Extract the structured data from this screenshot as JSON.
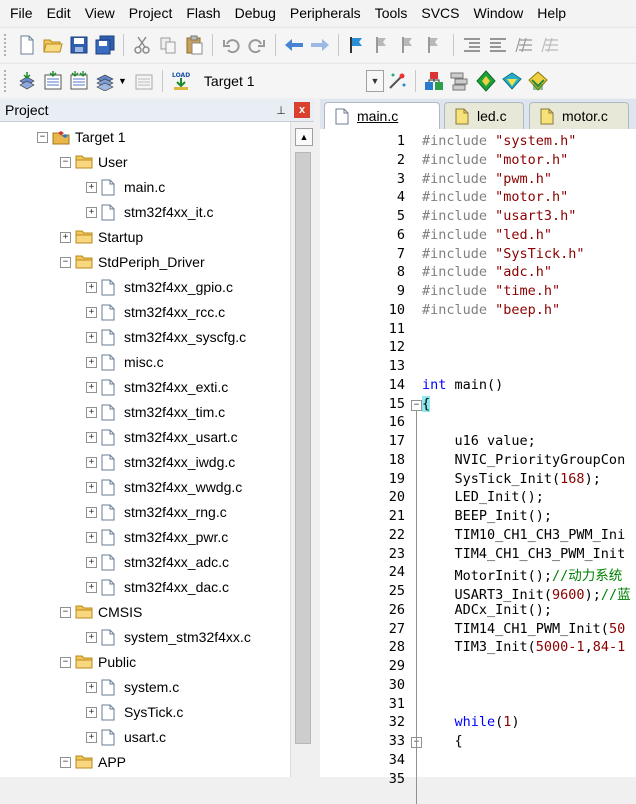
{
  "menu": [
    "File",
    "Edit",
    "View",
    "Project",
    "Flash",
    "Debug",
    "Peripherals",
    "Tools",
    "SVCS",
    "Window",
    "Help"
  ],
  "toolbar": {
    "target_name": "Target 1"
  },
  "project_panel": {
    "title": "Project",
    "pin": "⊥",
    "close": "x"
  },
  "tree": [
    {
      "label": "Target 1",
      "icon": "target-icon",
      "exp": "−"
    },
    {
      "label": "User",
      "icon": "folder-icon",
      "exp": "−"
    },
    {
      "label": "main.c",
      "icon": "file-icon",
      "exp": "+"
    },
    {
      "label": "stm32f4xx_it.c",
      "icon": "file-icon",
      "exp": "+"
    },
    {
      "label": "Startup",
      "icon": "folder-icon",
      "exp": "+"
    },
    {
      "label": "StdPeriph_Driver",
      "icon": "folder-icon",
      "exp": "−"
    },
    {
      "label": "stm32f4xx_gpio.c",
      "icon": "file-icon",
      "exp": "+"
    },
    {
      "label": "stm32f4xx_rcc.c",
      "icon": "file-icon",
      "exp": "+"
    },
    {
      "label": "stm32f4xx_syscfg.c",
      "icon": "file-icon",
      "exp": "+"
    },
    {
      "label": "misc.c",
      "icon": "file-icon",
      "exp": "+"
    },
    {
      "label": "stm32f4xx_exti.c",
      "icon": "file-icon",
      "exp": "+"
    },
    {
      "label": "stm32f4xx_tim.c",
      "icon": "file-icon",
      "exp": "+"
    },
    {
      "label": "stm32f4xx_usart.c",
      "icon": "file-icon",
      "exp": "+"
    },
    {
      "label": "stm32f4xx_iwdg.c",
      "icon": "file-icon",
      "exp": "+"
    },
    {
      "label": "stm32f4xx_wwdg.c",
      "icon": "file-icon",
      "exp": "+"
    },
    {
      "label": "stm32f4xx_rng.c",
      "icon": "file-icon",
      "exp": "+"
    },
    {
      "label": "stm32f4xx_pwr.c",
      "icon": "file-icon",
      "exp": "+"
    },
    {
      "label": "stm32f4xx_adc.c",
      "icon": "file-icon",
      "exp": "+"
    },
    {
      "label": "stm32f4xx_dac.c",
      "icon": "file-icon",
      "exp": "+"
    },
    {
      "label": "CMSIS",
      "icon": "folder-icon",
      "exp": "−"
    },
    {
      "label": "system_stm32f4xx.c",
      "icon": "file-icon",
      "exp": "+"
    },
    {
      "label": "Public",
      "icon": "folder-icon",
      "exp": "−"
    },
    {
      "label": "system.c",
      "icon": "file-icon",
      "exp": "+"
    },
    {
      "label": "SysTick.c",
      "icon": "file-icon",
      "exp": "+"
    },
    {
      "label": "usart.c",
      "icon": "file-icon",
      "exp": "+"
    },
    {
      "label": "APP",
      "icon": "folder-icon",
      "exp": "−"
    }
  ],
  "tabs": [
    {
      "label": "main.c",
      "active": true
    },
    {
      "label": "led.c",
      "active": false
    },
    {
      "label": "motor.c",
      "active": false
    }
  ],
  "editor": {
    "line_numbers": [
      "1",
      "2",
      "3",
      "4",
      "5",
      "6",
      "7",
      "8",
      "9",
      "10",
      "11",
      "12",
      "13",
      "14",
      "15",
      "16",
      "17",
      "18",
      "19",
      "20",
      "21",
      "22",
      "23",
      "24",
      "25",
      "26",
      "27",
      "28",
      "29",
      "30",
      "31",
      "32",
      "33",
      "34",
      "35"
    ],
    "code": [
      "#include \"system.h\"",
      "#include \"motor.h\"",
      "#include \"pwm.h\"",
      "#include \"motor.h\"",
      "#include \"usart3.h\"",
      "#include \"led.h\"",
      "#include \"SysTick.h\"",
      "#include \"adc.h\"",
      "#include \"time.h\"",
      "#include \"beep.h\"",
      "",
      "",
      "",
      "int main()",
      "{",
      "",
      "    u16 value;",
      "    NVIC_PriorityGroupCon",
      "    SysTick_Init(168);",
      "    LED_Init();",
      "    BEEP_Init();",
      "    TIM10_CH1_CH3_PWM_Ini",
      "    TIM4_CH1_CH3_PWM_Init",
      "    MotorInit();//动力系统",
      "    USART3_Init(9600);//蓝",
      "    ADCx_Init();",
      "    TIM14_CH1_PWM_Init(50",
      "    TIM3_Init(5000-1,84-1",
      "",
      "",
      "",
      "    while(1)",
      "    {",
      "",
      ""
    ]
  }
}
